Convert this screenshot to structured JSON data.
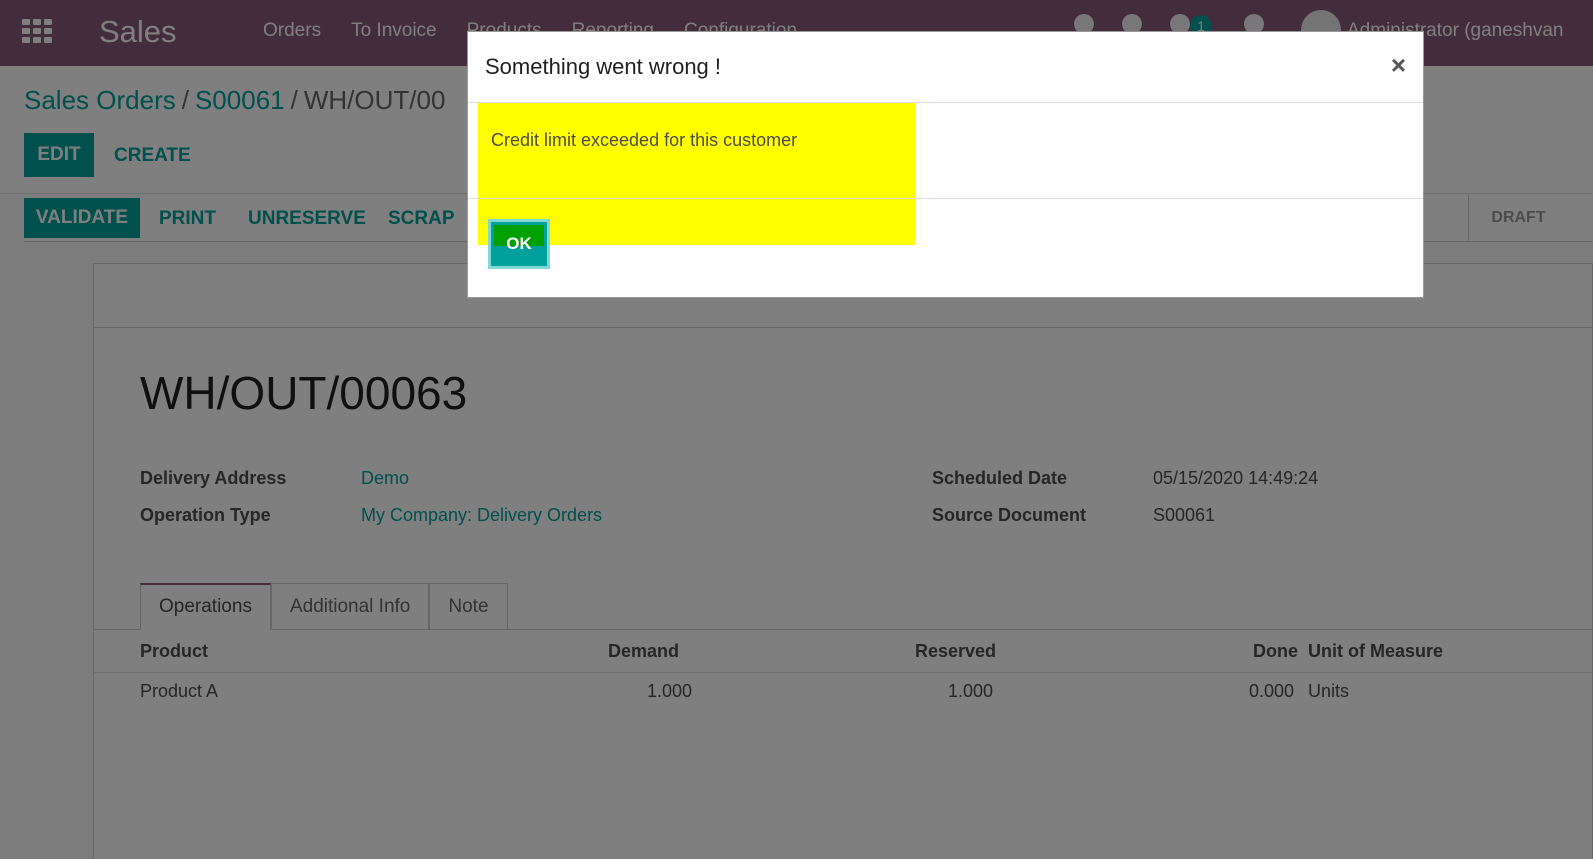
{
  "navbar": {
    "app_name": "Sales",
    "menu": [
      "Orders",
      "To Invoice",
      "Products",
      "Reporting",
      "Configuration"
    ],
    "chat_badge": "1",
    "user": "Administrator (ganeshvan"
  },
  "breadcrumb": {
    "sales_orders": "Sales Orders",
    "order": "S00061",
    "current": "WH/OUT/00"
  },
  "control": {
    "edit": "EDIT",
    "create": "CREATE"
  },
  "statusbar": {
    "validate": "VALIDATE",
    "print": "PRINT",
    "unreserve": "UNRESERVE",
    "scrap": "SCRAP",
    "draft": "DRAFT"
  },
  "form": {
    "title": "WH/OUT/00063",
    "delivery_address_label": "Delivery Address",
    "delivery_address": "Demo",
    "operation_type_label": "Operation Type",
    "operation_type": "My Company: Delivery Orders",
    "scheduled_date_label": "Scheduled Date",
    "scheduled_date": "05/15/2020 14:49:24",
    "source_document_label": "Source Document",
    "source_document": "S00061"
  },
  "tabs": [
    "Operations",
    "Additional Info",
    "Note"
  ],
  "table": {
    "headers": [
      "Product",
      "Demand",
      "Reserved",
      "Done",
      "Unit of Measure"
    ],
    "rows": [
      [
        "Product A",
        "1.000",
        "1.000",
        "0.000",
        "Units"
      ]
    ]
  },
  "dialog": {
    "title": "Something went wrong !",
    "close": "×",
    "message": "Credit limit exceeded for this customer",
    "ok": "OK"
  }
}
